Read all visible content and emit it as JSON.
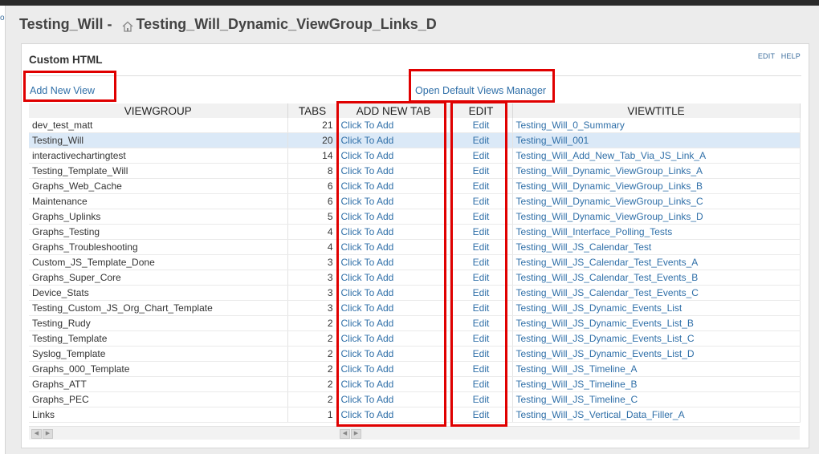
{
  "page": {
    "title_part1": "Testing_Will",
    "title_sep": " - ",
    "title_part2": "Testing_Will_Dynamic_ViewGroup_Links_D"
  },
  "left_strip": {
    "glyph": "o"
  },
  "panel": {
    "title": "Custom HTML",
    "actions": {
      "edit": "EDIT",
      "help": "HELP"
    },
    "add_new_view": "Add New View",
    "open_manager": "Open Default Views Manager"
  },
  "table": {
    "headers": [
      "VIEWGROUP",
      "TABS",
      "ADD NEW TAB",
      "EDIT",
      "VIEWTITLE"
    ],
    "rows": [
      {
        "viewgroup": "dev_test_matt",
        "tabs": "21",
        "add": "Click To Add",
        "edit": "Edit",
        "viewtitle": "Testing_Will_0_Summary"
      },
      {
        "viewgroup": "Testing_Will",
        "tabs": "20",
        "add": "Click To Add",
        "edit": "Edit",
        "viewtitle": "Testing_Will_001"
      },
      {
        "viewgroup": "interactivechartingtest",
        "tabs": "14",
        "add": "Click To Add",
        "edit": "Edit",
        "viewtitle": "Testing_Will_Add_New_Tab_Via_JS_Link_A"
      },
      {
        "viewgroup": "Testing_Template_Will",
        "tabs": "8",
        "add": "Click To Add",
        "edit": "Edit",
        "viewtitle": "Testing_Will_Dynamic_ViewGroup_Links_A"
      },
      {
        "viewgroup": "Graphs_Web_Cache",
        "tabs": "6",
        "add": "Click To Add",
        "edit": "Edit",
        "viewtitle": "Testing_Will_Dynamic_ViewGroup_Links_B"
      },
      {
        "viewgroup": "Maintenance",
        "tabs": "6",
        "add": "Click To Add",
        "edit": "Edit",
        "viewtitle": "Testing_Will_Dynamic_ViewGroup_Links_C"
      },
      {
        "viewgroup": "Graphs_Uplinks",
        "tabs": "5",
        "add": "Click To Add",
        "edit": "Edit",
        "viewtitle": "Testing_Will_Dynamic_ViewGroup_Links_D"
      },
      {
        "viewgroup": "Graphs_Testing",
        "tabs": "4",
        "add": "Click To Add",
        "edit": "Edit",
        "viewtitle": "Testing_Will_Interface_Polling_Tests"
      },
      {
        "viewgroup": "Graphs_Troubleshooting",
        "tabs": "4",
        "add": "Click To Add",
        "edit": "Edit",
        "viewtitle": "Testing_Will_JS_Calendar_Test"
      },
      {
        "viewgroup": "Custom_JS_Template_Done",
        "tabs": "3",
        "add": "Click To Add",
        "edit": "Edit",
        "viewtitle": "Testing_Will_JS_Calendar_Test_Events_A"
      },
      {
        "viewgroup": "Graphs_Super_Core",
        "tabs": "3",
        "add": "Click To Add",
        "edit": "Edit",
        "viewtitle": "Testing_Will_JS_Calendar_Test_Events_B"
      },
      {
        "viewgroup": "Device_Stats",
        "tabs": "3",
        "add": "Click To Add",
        "edit": "Edit",
        "viewtitle": "Testing_Will_JS_Calendar_Test_Events_C"
      },
      {
        "viewgroup": "Testing_Custom_JS_Org_Chart_Template",
        "tabs": "3",
        "add": "Click To Add",
        "edit": "Edit",
        "viewtitle": "Testing_Will_JS_Dynamic_Events_List"
      },
      {
        "viewgroup": "Testing_Rudy",
        "tabs": "2",
        "add": "Click To Add",
        "edit": "Edit",
        "viewtitle": "Testing_Will_JS_Dynamic_Events_List_B"
      },
      {
        "viewgroup": "Testing_Template",
        "tabs": "2",
        "add": "Click To Add",
        "edit": "Edit",
        "viewtitle": "Testing_Will_JS_Dynamic_Events_List_C"
      },
      {
        "viewgroup": "Syslog_Template",
        "tabs": "2",
        "add": "Click To Add",
        "edit": "Edit",
        "viewtitle": "Testing_Will_JS_Dynamic_Events_List_D"
      },
      {
        "viewgroup": "Graphs_000_Template",
        "tabs": "2",
        "add": "Click To Add",
        "edit": "Edit",
        "viewtitle": "Testing_Will_JS_Timeline_A"
      },
      {
        "viewgroup": "Graphs_ATT",
        "tabs": "2",
        "add": "Click To Add",
        "edit": "Edit",
        "viewtitle": "Testing_Will_JS_Timeline_B"
      },
      {
        "viewgroup": "Graphs_PEC",
        "tabs": "2",
        "add": "Click To Add",
        "edit": "Edit",
        "viewtitle": "Testing_Will_JS_Timeline_C"
      },
      {
        "viewgroup": "Links",
        "tabs": "1",
        "add": "Click To Add",
        "edit": "Edit",
        "viewtitle": "Testing_Will_JS_Vertical_Data_Filler_A"
      }
    ],
    "selected_row": "Testing_Will"
  },
  "scrollbar": {
    "left_arrow": "◀",
    "right_arrow": "▶"
  },
  "colors": {
    "link": "#2f6fa8",
    "highlight_box": "#e00000",
    "selected_row": "#dbe9f7"
  },
  "icons": {
    "breadcrumb": "home-icon"
  }
}
